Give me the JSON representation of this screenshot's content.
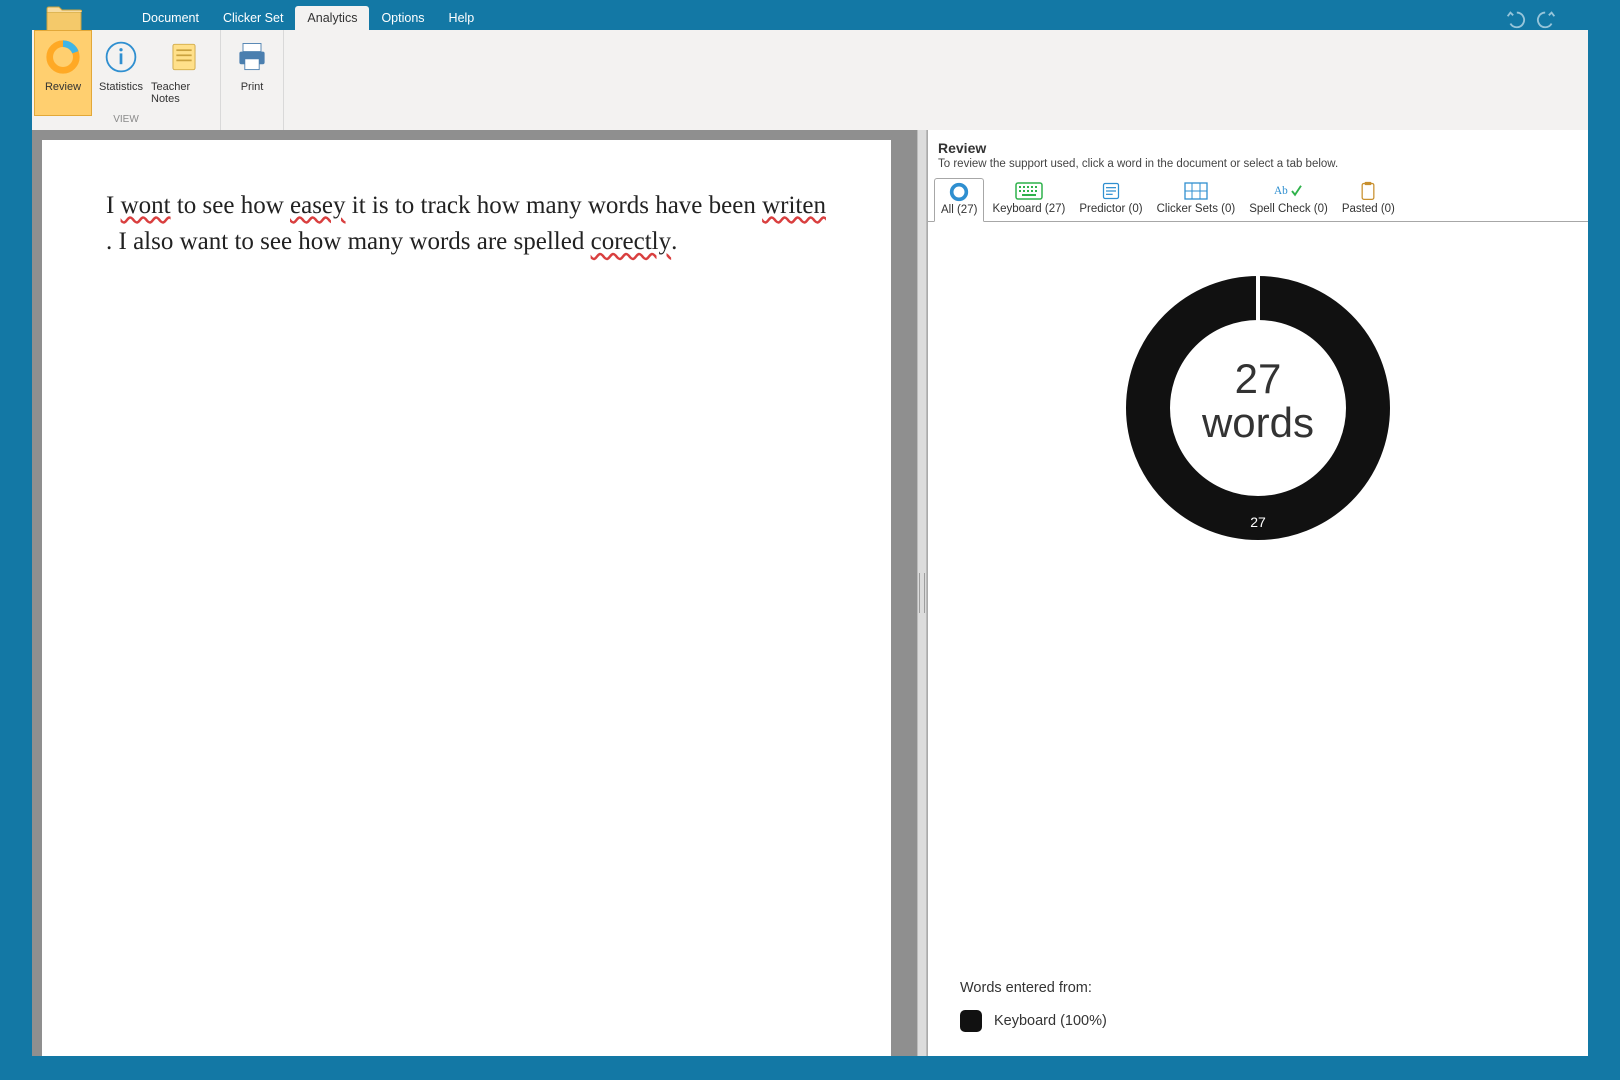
{
  "menus": {
    "document": "Document",
    "clickerset": "Clicker Set",
    "analytics": "Analytics",
    "options": "Options",
    "help": "Help"
  },
  "ribbon": {
    "review": "Review",
    "statistics": "Statistics",
    "teachernotes": "Teacher Notes",
    "print": "Print",
    "group_view": "VIEW"
  },
  "document_text": {
    "w": [
      "I ",
      "wont",
      " to see how ",
      "easey",
      " it is to track how many words have been ",
      "writen",
      ". I also want to see how many words are spelled ",
      "corectly",
      "."
    ]
  },
  "panel": {
    "title": "Review",
    "subtitle": "To review the support used, click a word in the document or select a tab below.",
    "tabs": {
      "all": "All (27)",
      "keyboard": "Keyboard (27)",
      "predictor": "Predictor (0)",
      "clickersets": "Clicker Sets (0)",
      "spellcheck": "Spell Check (0)",
      "pasted": "Pasted (0)"
    },
    "legend_title": "Words entered from:",
    "legend_item": "Keyboard (100%)"
  },
  "chart_data": {
    "type": "pie",
    "title": "",
    "categories": [
      "Keyboard"
    ],
    "values": [
      27
    ],
    "total": 27,
    "center_number": "27",
    "center_label": "words",
    "bottom_label": "27",
    "colors": [
      "#111111"
    ]
  }
}
